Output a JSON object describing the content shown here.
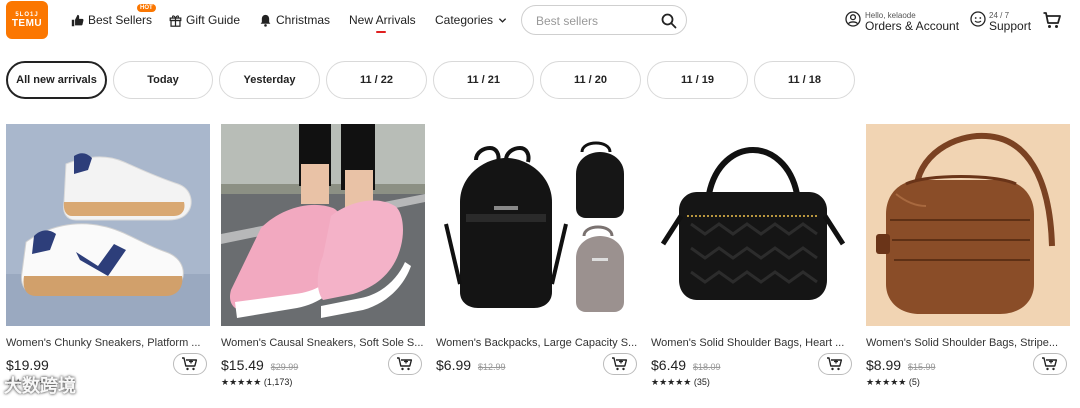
{
  "header": {
    "logo": {
      "line1": "5LO1J",
      "line2": "TEMU"
    },
    "nav": [
      {
        "label": "Best Sellers",
        "badge": "HOT",
        "icon": "thumbs-up-icon"
      },
      {
        "label": "Gift Guide",
        "icon": "gift-icon"
      },
      {
        "label": "Christmas",
        "icon": "bell-icon"
      },
      {
        "label": "New Arrivals"
      },
      {
        "label": "Categories",
        "icon": "chevron-down-icon"
      }
    ],
    "search": {
      "placeholder": "Best sellers"
    },
    "account": {
      "greeting": "Hello, kelaode",
      "label": "Orders & Account"
    },
    "support": {
      "top": "24 / 7",
      "label": "Support"
    }
  },
  "date_filters": [
    "All new arrivals",
    "Today",
    "Yesterday",
    "11 / 22",
    "11 / 21",
    "11 / 20",
    "11 / 19",
    "11 / 18"
  ],
  "products": [
    {
      "title": "Women's Chunky Sneakers, Platform ...",
      "price": "$19.99",
      "old_price": "",
      "rating": "★★★★★",
      "reviews": ""
    },
    {
      "title": "Women's Causal Sneakers, Soft Sole S...",
      "price": "$15.49",
      "old_price": "$29.99",
      "rating": "★★★★★",
      "reviews": "(1,173)"
    },
    {
      "title": "Women's Backpacks, Large Capacity S...",
      "price": "$6.99",
      "old_price": "$12.99",
      "rating": "",
      "reviews": ""
    },
    {
      "title": "Women's Solid Shoulder Bags, Heart ...",
      "price": "$6.49",
      "old_price": "$18.09",
      "rating": "★★★★★",
      "reviews": "(35)"
    },
    {
      "title": "Women's Solid Shoulder Bags, Stripe...",
      "price": "$8.99",
      "old_price": "$15.99",
      "rating": "★★★★★",
      "reviews": "(5)"
    }
  ],
  "watermark": "大数跨境",
  "colors": {
    "brand": "#fb7701",
    "active_underline": "#e02020"
  }
}
